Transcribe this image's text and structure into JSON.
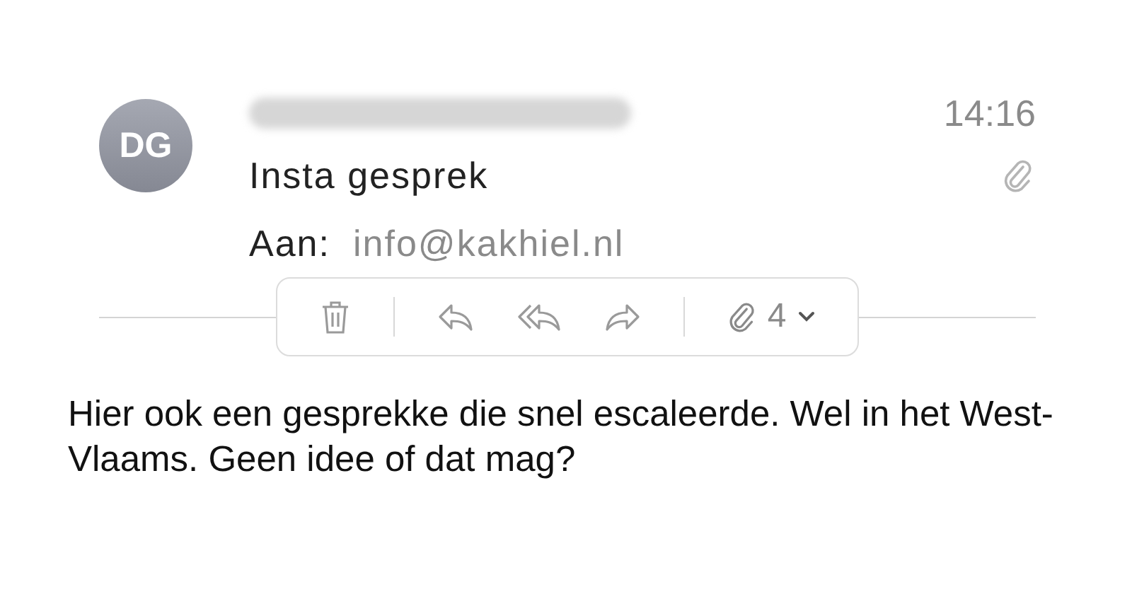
{
  "message": {
    "avatar_initials": "DG",
    "time": "14:16",
    "subject": "Insta gesprek",
    "has_attachment": true,
    "to_label": "Aan:",
    "to_address": "info@kakhiel.nl"
  },
  "toolbar": {
    "attachment_count": "4"
  },
  "body": "Hier ook een gesprekke die snel escaleerde. Wel in het West-Vlaams. Geen idee of dat mag?"
}
